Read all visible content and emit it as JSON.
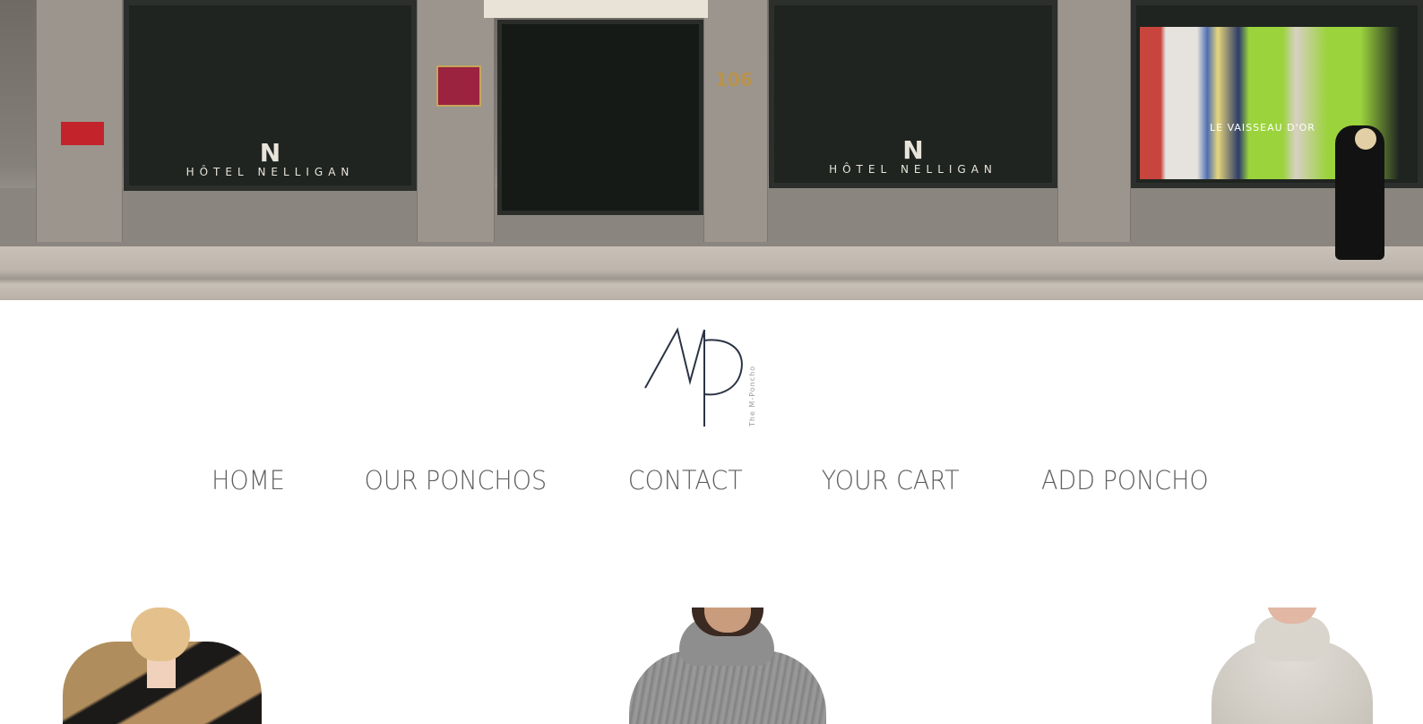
{
  "hero": {
    "alt": "storefront street photo",
    "window_sign_left": "HÔTEL NELLIGAN",
    "window_sign_right": "HÔTEL NELLIGAN",
    "window_monogram": "N",
    "entrance_number": "106",
    "store_sign": "LE VAISSEAU D'OR"
  },
  "logo": {
    "mark": "MP",
    "tagline": "The M-Poncho"
  },
  "nav": {
    "items": [
      {
        "label": "HOME"
      },
      {
        "label": "OUR PONCHOS"
      },
      {
        "label": "CONTACT"
      },
      {
        "label": "YOUR CART"
      },
      {
        "label": "ADD PONCHO"
      }
    ]
  },
  "products": [
    {
      "name": "camel and black poncho"
    },
    {
      "name": "grey turtleneck poncho"
    },
    {
      "name": "cream knit poncho"
    }
  ],
  "colors": {
    "nav_text": "#5f5f5f",
    "logo_stroke": "#2b3445",
    "background": "#ffffff"
  }
}
